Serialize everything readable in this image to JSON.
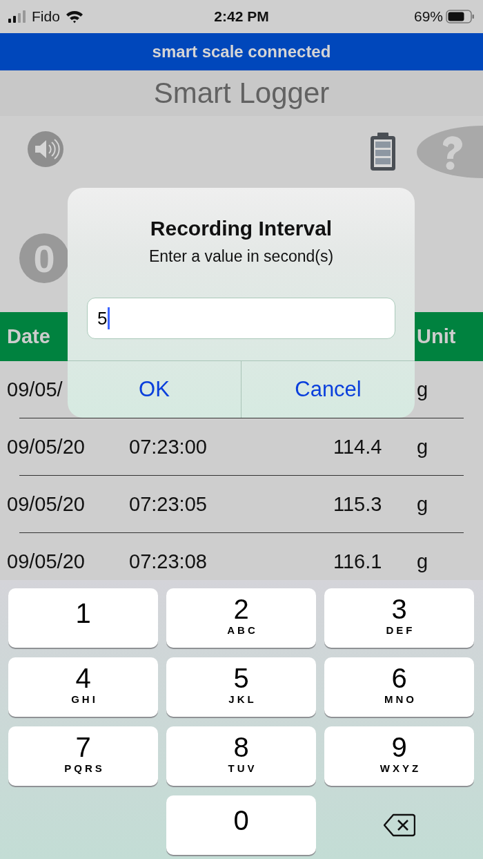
{
  "status_bar": {
    "carrier": "Fido",
    "time": "2:42 PM",
    "battery": "69%"
  },
  "banner": "smart scale connected",
  "title": "Smart Logger",
  "counter": "0",
  "table": {
    "header": {
      "date": "Date",
      "unit": "Unit"
    },
    "rows": [
      {
        "date": "09/05/",
        "unit": "g"
      },
      {
        "date": "09/05/20",
        "column_2": "07:23:00",
        "column_3": "114.4",
        "unit": "g"
      },
      {
        "date": "09/05/20",
        "column_2": "07:23:05",
        "column_3": "115.3",
        "unit": "g"
      },
      {
        "date": "09/05/20",
        "column_2": "07:23:08",
        "column_3": "116.1",
        "unit": "g"
      }
    ]
  },
  "dialog": {
    "title": "Recording Interval",
    "message": "Enter a value in second(s)",
    "input": {
      "value": "5",
      "focused": true
    },
    "buttons": [
      {
        "label": "OK"
      },
      {
        "label": "Cancel"
      }
    ]
  },
  "keypad": {
    "keys": [
      {
        "kind": "digit",
        "digit": "1"
      },
      {
        "kind": "digit",
        "digit": "2",
        "letters": "ABC"
      },
      {
        "kind": "digit",
        "digit": "3",
        "letters": "DEF"
      },
      {
        "kind": "digit",
        "digit": "4",
        "letters": "GHI"
      },
      {
        "kind": "digit",
        "digit": "5",
        "letters": "JKL"
      },
      {
        "kind": "digit",
        "digit": "6",
        "letters": "MNO"
      },
      {
        "kind": "digit",
        "digit": "7",
        "letters": "PQRS"
      },
      {
        "kind": "digit",
        "digit": "8",
        "letters": "TUV"
      },
      {
        "kind": "digit",
        "digit": "9",
        "letters": "WXYZ"
      },
      {
        "kind": "spacer"
      },
      {
        "kind": "digit",
        "digit": "0"
      },
      {
        "kind": "delete"
      }
    ]
  }
}
